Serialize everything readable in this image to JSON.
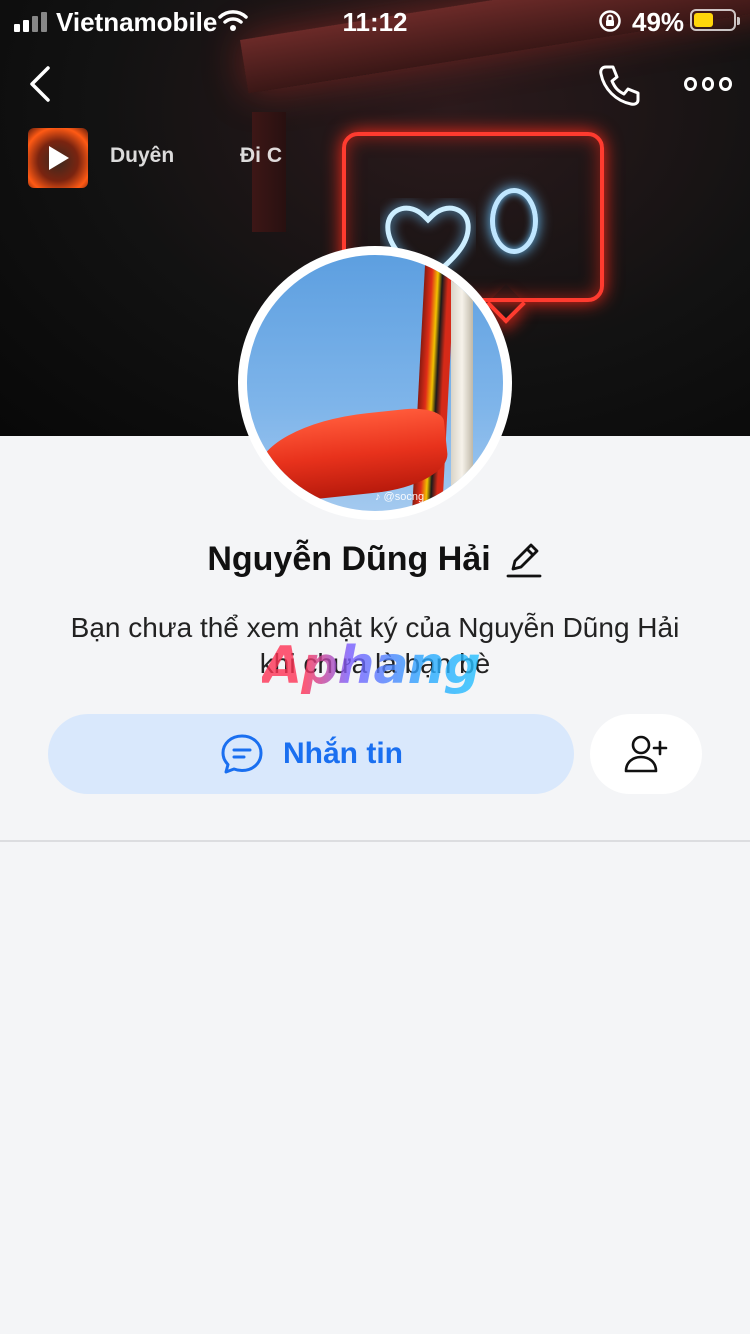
{
  "status_bar": {
    "carrier": "Vietnamobile",
    "time": "11:12",
    "battery_percent": "49%",
    "battery_level": 0.49,
    "battery_color": "#ffd60a"
  },
  "nav": {
    "back_icon": "chevron-left-icon",
    "call_icon": "phone-icon",
    "more_icon": "more-dots-icon"
  },
  "music": {
    "text_primary": "Duyên",
    "text_secondary": "Đi C"
  },
  "avatar": {
    "watermark": "♪ @socng"
  },
  "profile": {
    "name": "Nguyễn Dũng Hải",
    "edit_icon": "pencil-icon",
    "notice": "Bạn chưa thể xem nhật ký của Nguyễn Dũng Hải khi chưa là bạn bè"
  },
  "overlay_brand": "Aphang",
  "actions": {
    "message_label": "Nhắn tin",
    "message_icon": "chat-bubble-icon",
    "add_friend_icon": "add-friend-icon",
    "accent_color": "#1a6ff0"
  }
}
